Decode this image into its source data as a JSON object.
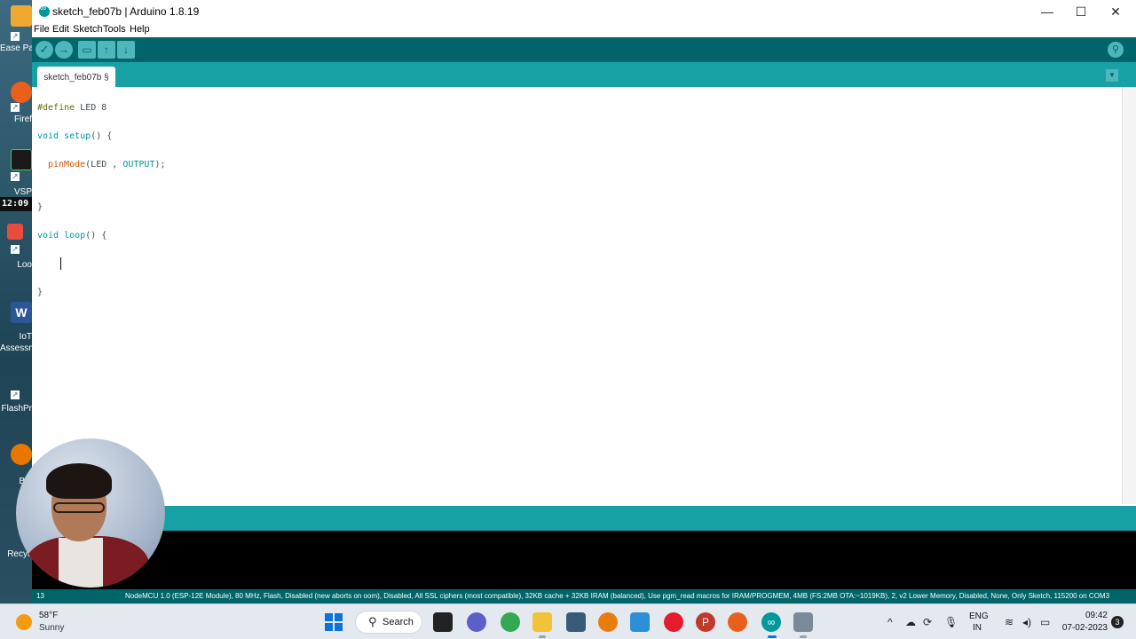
{
  "desktop": {
    "clock_badge": "12:09",
    "icons": [
      {
        "label": "Ease Parti",
        "icon": "easeus-partition-icon"
      },
      {
        "label": "Firef",
        "icon": "firefox-icon"
      },
      {
        "label": "VSP",
        "icon": "vsp-icon"
      },
      {
        "label": "Loo",
        "icon": "loom-icon"
      },
      {
        "label": "IoT Assessm",
        "icon": "word-doc-icon"
      },
      {
        "label": "FlashPr",
        "icon": "flashprint-icon"
      },
      {
        "label": "Ble",
        "icon": "blender-icon"
      },
      {
        "label": "Recyc",
        "icon": "recycle-bin-icon"
      }
    ]
  },
  "window": {
    "title": "sketch_feb07b | Arduino 1.8.19",
    "controls": {
      "minimize": "—",
      "maximize": "☐",
      "close": "✕"
    }
  },
  "menu": {
    "file": "File",
    "edit": "Edit",
    "sketch": "Sketch",
    "tools": "Tools",
    "help": "Help"
  },
  "toolbar": {
    "verify": "✓",
    "upload": "→",
    "new": "▭",
    "open": "↑",
    "save": "↓",
    "serial_monitor": "⚲"
  },
  "tabs": {
    "active": "sketch_feb07b §",
    "menu": "▼"
  },
  "code": {
    "line1_pp": "#define",
    "line1_rest": " LED 8",
    "line2_kw": "void",
    "line2_fn": " setup",
    "line2_rest": "() {",
    "line3_fn": "pinMode",
    "line3_mid": "(LED , ",
    "line3_const": "OUTPUT",
    "line3_end": ");",
    "line4": "}",
    "line5_kw": "void",
    "line5_fn": " loop",
    "line5_rest": "() {",
    "line6": "}"
  },
  "statusbar": {
    "line_number": "13",
    "board_info": "NodeMCU 1.0 (ESP-12E Module), 80 MHz, Flash, Disabled (new aborts on oom), Disabled, All SSL ciphers (most compatible), 32KB cache + 32KB IRAM (balanced), Use pgm_read macros for IRAM/PROGMEM, 4MB (FS:2MB OTA:~1019KB), 2, v2 Lower Memory, Disabled, None, Only Sketch, 115200 on COM3"
  },
  "taskbar": {
    "weather_temp": "58°F",
    "weather_desc": "Sunny",
    "search_label": "Search",
    "lang_line1": "ENG",
    "lang_line2": "IN",
    "time": "09:42",
    "date": "07-02-2023",
    "notification_count": "3"
  }
}
